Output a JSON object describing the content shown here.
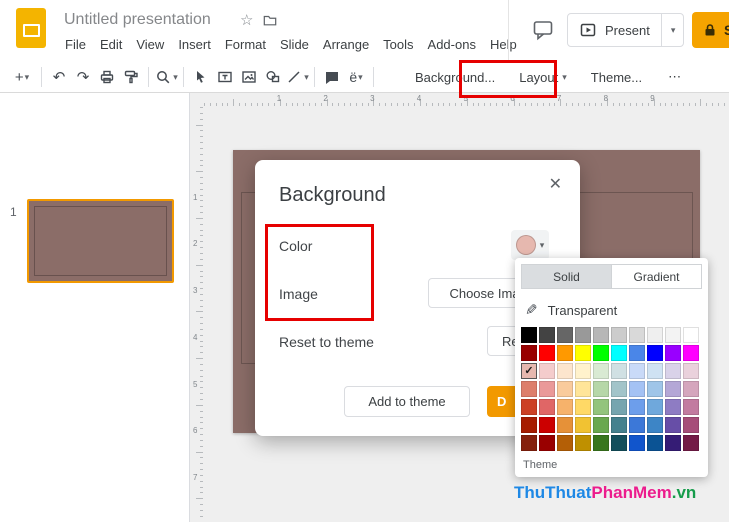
{
  "header": {
    "doc_title": "Untitled presentation",
    "menus": [
      "File",
      "Edit",
      "View",
      "Insert",
      "Format",
      "Slide",
      "Arrange",
      "Tools",
      "Add-ons",
      "Help"
    ],
    "present_label": "Present",
    "share_label": "S"
  },
  "toolbar": {
    "background_button": "Background...",
    "layout_button": "Layout",
    "theme_button": "Theme...",
    "special_char": "ё"
  },
  "slide_panel": {
    "slide_number": "1"
  },
  "rulers": {
    "horizontal": [
      "1",
      "2",
      "3",
      "4",
      "5",
      "6",
      "7",
      "8",
      "9"
    ],
    "vertical": [
      "1",
      "2",
      "3",
      "4",
      "5",
      "6",
      "7"
    ]
  },
  "dialog": {
    "title": "Background",
    "color_label": "Color",
    "image_label": "Image",
    "choose_image_button": "Choose Ima",
    "reset_label": "Reset to theme",
    "reset_button": "Re",
    "add_to_theme_button": "Add to theme",
    "done_button": "D",
    "swatch_color": "#e6b8af"
  },
  "color_picker": {
    "tabs": [
      "Solid",
      "Gradient"
    ],
    "active_tab": "Solid",
    "transparent_label": "Transparent",
    "theme_section_label": "Theme",
    "selected": {
      "row": 2,
      "col": 0
    },
    "grid": [
      [
        "#000000",
        "#434343",
        "#666666",
        "#999999",
        "#b7b7b7",
        "#cccccc",
        "#d9d9d9",
        "#efefef",
        "#f3f3f3",
        "#ffffff"
      ],
      [
        "#980000",
        "#ff0000",
        "#ff9900",
        "#ffff00",
        "#00ff00",
        "#00ffff",
        "#4a86e8",
        "#0000ff",
        "#9900ff",
        "#ff00ff"
      ],
      [
        "#e6b8af",
        "#f4cccc",
        "#fce5cd",
        "#fff2cc",
        "#d9ead3",
        "#d0e0e3",
        "#c9daf8",
        "#cfe2f3",
        "#d9d2e9",
        "#ead1dc"
      ],
      [
        "#dd7e6b",
        "#ea9999",
        "#f9cb9c",
        "#ffe599",
        "#b6d7a8",
        "#a2c4c9",
        "#a4c2f4",
        "#9fc5e8",
        "#b4a7d6",
        "#d5a6bd"
      ],
      [
        "#cc4125",
        "#e06666",
        "#f6b26b",
        "#ffd966",
        "#93c47d",
        "#76a5af",
        "#6d9eeb",
        "#6fa8dc",
        "#8e7cc3",
        "#c27ba0"
      ],
      [
        "#a61c00",
        "#cc0000",
        "#e69138",
        "#f1c232",
        "#6aa84f",
        "#45818e",
        "#3c78d8",
        "#3d85c6",
        "#674ea7",
        "#a64d79"
      ],
      [
        "#85200c",
        "#990000",
        "#b45f06",
        "#bf9000",
        "#38761d",
        "#134f5c",
        "#1155cc",
        "#0b5394",
        "#351c75",
        "#741b47"
      ]
    ]
  },
  "watermark": {
    "p1": "ThuThuat",
    "p2": "PhanMem",
    "p3": ".vn",
    "color1": "#1e88e5",
    "color2": "#ec1c8d",
    "color3": "#169c4b"
  },
  "icons": {
    "caret": "▾",
    "more": "⋯",
    "close": "✕",
    "check": "✓",
    "plus": "+",
    "undo": "↶",
    "redo": "↷",
    "star": "☆",
    "transparent_pen": "✎"
  },
  "colors": {
    "slide_background": "#8b6d68",
    "accent_yellow": "#f4b400",
    "share_button": "#f5a300",
    "done_button": "#f29900",
    "annotation_red": "#e60000",
    "selected_swatch": "#e6b8af"
  }
}
